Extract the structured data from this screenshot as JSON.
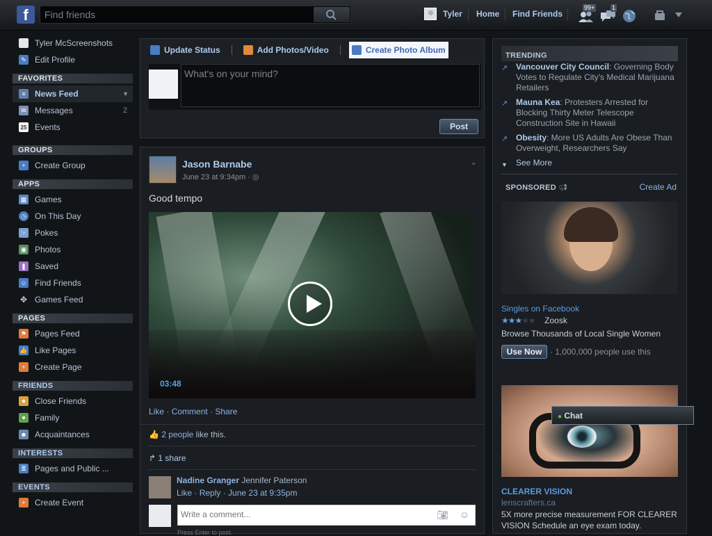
{
  "topbar": {
    "logo": "f",
    "search_placeholder": "Find friends",
    "user_name": "Tyler",
    "home": "Home",
    "find_friends": "Find Friends",
    "friend_requests_count": "99+",
    "messages_count": "1"
  },
  "sidebar": {
    "profile_name": "Tyler McScreenshots",
    "edit_profile": "Edit Profile",
    "favorites_header": "FAVORITES",
    "favorites": [
      {
        "label": "News Feed",
        "count": ""
      },
      {
        "label": "Messages",
        "count": "2"
      },
      {
        "label": "Events",
        "count": ""
      }
    ],
    "events_icon_text": "25",
    "groups_header": "GROUPS",
    "groups": [
      {
        "label": "Create Group"
      }
    ],
    "apps_header": "APPS",
    "apps": [
      {
        "label": "Games"
      },
      {
        "label": "On This Day"
      },
      {
        "label": "Pokes"
      },
      {
        "label": "Photos"
      },
      {
        "label": "Saved"
      },
      {
        "label": "Find Friends"
      },
      {
        "label": "Games Feed"
      }
    ],
    "pages_header": "PAGES",
    "pages": [
      {
        "label": "Pages Feed"
      },
      {
        "label": "Like Pages"
      },
      {
        "label": "Create Page"
      }
    ],
    "friends_header": "FRIENDS",
    "friends": [
      {
        "label": "Close Friends"
      },
      {
        "label": "Family"
      },
      {
        "label": "Acquaintances"
      }
    ],
    "interests_header": "INTERESTS",
    "interests": [
      {
        "label": "Pages and Public ..."
      }
    ],
    "events_header": "EVENTS",
    "events": [
      {
        "label": "Create Event"
      }
    ]
  },
  "composer": {
    "tabs": [
      "Update Status",
      "Add Photos/Video",
      "Create Photo Album"
    ],
    "placeholder": "What's on your mind?",
    "post": "Post"
  },
  "story": {
    "author": "Jason Barnabe",
    "time": "June 23 at 9:34pm ·",
    "text": "Good tempo",
    "video_duration": "03:48",
    "actions": [
      "Like",
      "Comment",
      "Share"
    ],
    "likes_link": "2 people",
    "likes_suffix": " like this.",
    "shares": "1 share",
    "comment": {
      "author": "Nadine Granger",
      "text": "Jennifer Paterson",
      "like": "Like",
      "reply": "Reply",
      "time": "June 23 at 9:35pm"
    },
    "comment_placeholder": "Write a comment...",
    "press_enter": "Press Enter to post."
  },
  "right": {
    "trending_header": "TRENDING",
    "trends": [
      {
        "topic": "Vancouver City Council",
        "text": ": Governing Body Votes to Regulate City's Medical Marijuana Retailers"
      },
      {
        "topic": "Mauna Kea",
        "text": ": Protesters Arrested for Blocking Thirty Meter Telescope Construction Site in Hawaii"
      },
      {
        "topic": "Obesity",
        "text": ": More US Adults Are Obese Than Overweight, Researchers Say"
      }
    ],
    "see_more": "See More",
    "sponsored_header": "SPONSORED",
    "create_ad": "Create Ad",
    "ad1": {
      "title": "Singles on Facebook",
      "rating": 2.5,
      "brand": "Zoosk",
      "desc": "Browse Thousands of Local Single Women",
      "button": "Use Now",
      "users": "· 1,000,000 people use this"
    },
    "ad2": {
      "title": "CLEARER VISION",
      "url": "lenscrafters.ca",
      "desc": "5X more precise measurement FOR CLEARER VISION Schedule an eye exam today."
    },
    "chat": "Chat"
  },
  "colors": {
    "link": "#8fb4e2",
    "accent": "#4267b2",
    "background": "#121518"
  }
}
